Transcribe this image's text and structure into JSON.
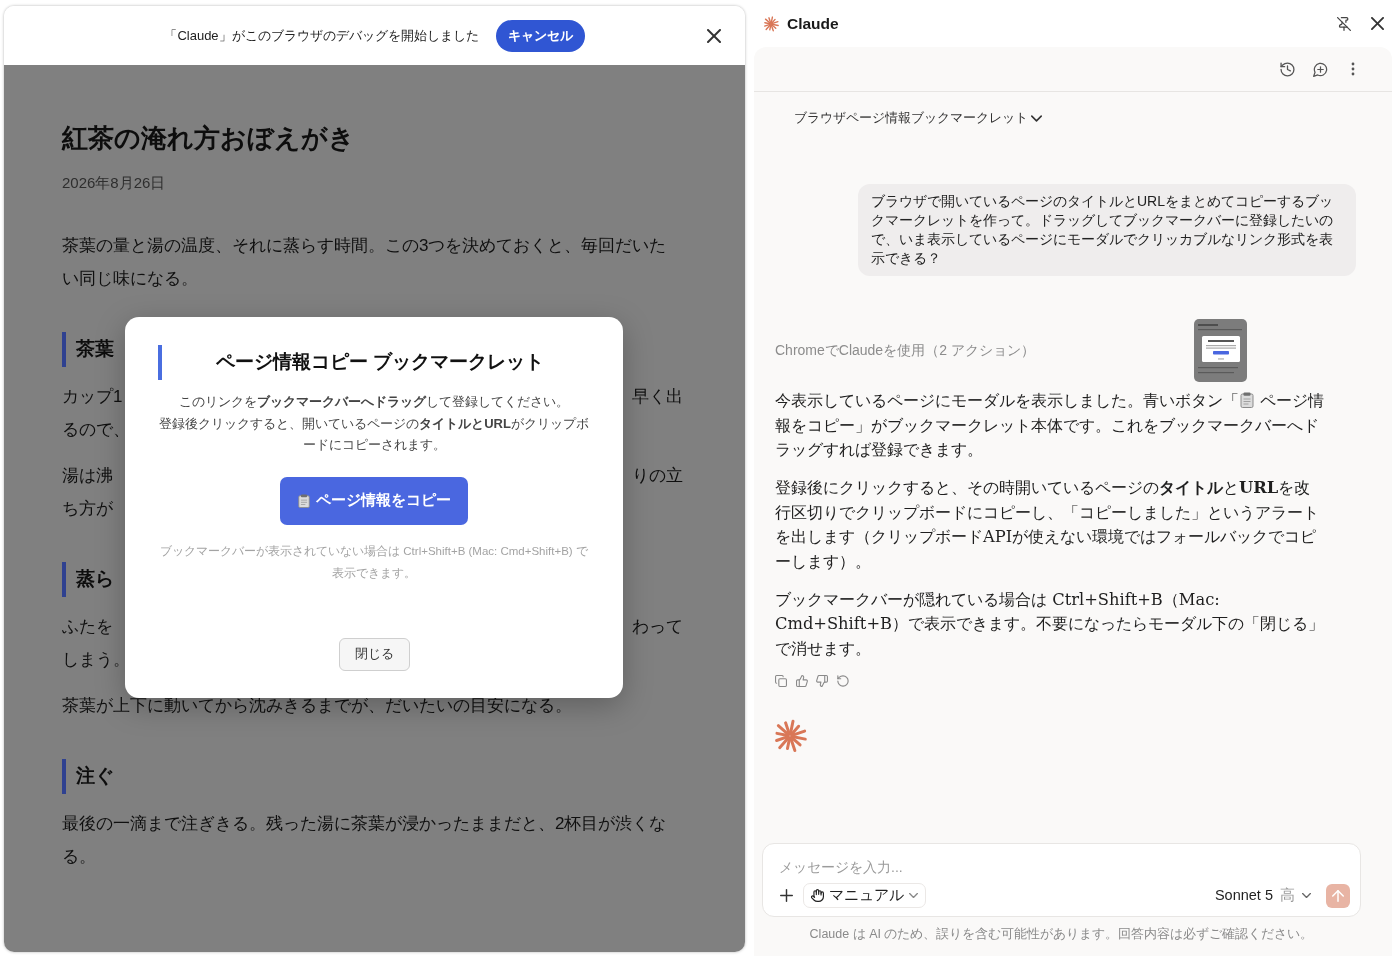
{
  "debug_banner": {
    "message": "「Claude」がこのブラウザのデバッグを開始しました",
    "cancel_button": "キャンセル"
  },
  "article": {
    "title": "紅茶の淹れ方おぼえがき",
    "date": "2026年8月26日",
    "blocks": [
      {
        "kind": "paragraph",
        "text": "茶葉の量と湯の温度、それに蒸らす時間。この3つを決めておくと、毎回だいたい同じ味になる。"
      },
      {
        "kind": "heading",
        "text": "茶葉"
      },
      {
        "kind": "split_paragraph",
        "lines": [
          {
            "left": "カップ1",
            "right": "早く出"
          },
          {
            "left": "るので、"
          }
        ]
      },
      {
        "kind": "split_paragraph",
        "lines": [
          {
            "left": "湯は沸",
            "right": "りの立"
          },
          {
            "left": "ち方が"
          }
        ]
      },
      {
        "kind": "heading",
        "text": "蒸ら"
      },
      {
        "kind": "split_paragraph",
        "lines": [
          {
            "left": "ふたを",
            "right": "わって"
          },
          {
            "left": "しまう。"
          }
        ]
      },
      {
        "kind": "paragraph",
        "text": "茶葉が上下に動いてから沈みきるまでが、だいたいの目安になる。"
      },
      {
        "kind": "heading",
        "text": "注ぐ"
      },
      {
        "kind": "paragraph",
        "text": "最後の一滴まで注ぎきる。残った湯に茶葉が浸かったままだと、2杯目が渋くなる。"
      }
    ]
  },
  "modal": {
    "title": "ページ情報コピー ブックマークレット",
    "description_lines": [
      "このリンクを**ブックマークバーへドラッグ**して登録してください。",
      "登録後クリックすると、開いているページの**タイトルとURL**がクリップボードにコピーされます。"
    ],
    "copy_button": "ページ情報をコピー",
    "note": "ブックマークバーが表示されていない場合は Ctrl+Shift+B (Mac: Cmd+Shift+B) で表示できます。",
    "close_button": "閉じる"
  },
  "side_panel": {
    "title": "Claude",
    "chat_title": "ブラウザページ情報ブックマークレット",
    "messages": [
      {
        "kind": "user",
        "text": "ブラウザで開いているページのタイトルとURLをまとめてコピーするブックマークレットを作って。ドラッグしてブックマークバーに登録したいので、いま表示しているページにモーダルでクリッカブルなリンク形式を表示できる？"
      },
      {
        "kind": "tool_use",
        "text": "ChromeでClaudeを使用（2 アクション）"
      },
      {
        "kind": "assistant",
        "paragraphs": [
          {
            "parts": [
              {
                "kind": "text",
                "text": "今表示しているページにモーダルを表示しました。青いボタン「"
              },
              {
                "kind": "clipboard_icon"
              },
              {
                "kind": "text",
                "text": " ページ情報をコピー」がブックマークレット本体です。これをブックマークバーへドラッグすれば登録できます。"
              }
            ]
          },
          {
            "parts": [
              {
                "kind": "text",
                "text": "登録後にクリックすると、その時開いているページの**タイトル**と**URL**を改行区切りでクリップボードにコピーし、「コピーしました」というアラートを出します（クリップボードAPIが使えない環境ではフォールバックでコピーします）。"
              }
            ]
          },
          {
            "parts": [
              {
                "kind": "text",
                "text": "ブックマークバーが隠れている場合は Ctrl+Shift+B（Mac: Cmd+Shift+B）で表示できます。不要になったらモーダル下の「閉じる」で消せます。"
              }
            ]
          }
        ]
      },
      {
        "kind": "loading"
      }
    ],
    "composer": {
      "placeholder": "メッセージを入力...",
      "mode": "マニュアル",
      "model": "Sonnet 5",
      "effort": "高",
      "send_button": {
        "disabled": true
      }
    },
    "disclaimer": "Claude は AI のため、誤りを含む可能性があります。回答内容は必ずご確認ください。"
  }
}
